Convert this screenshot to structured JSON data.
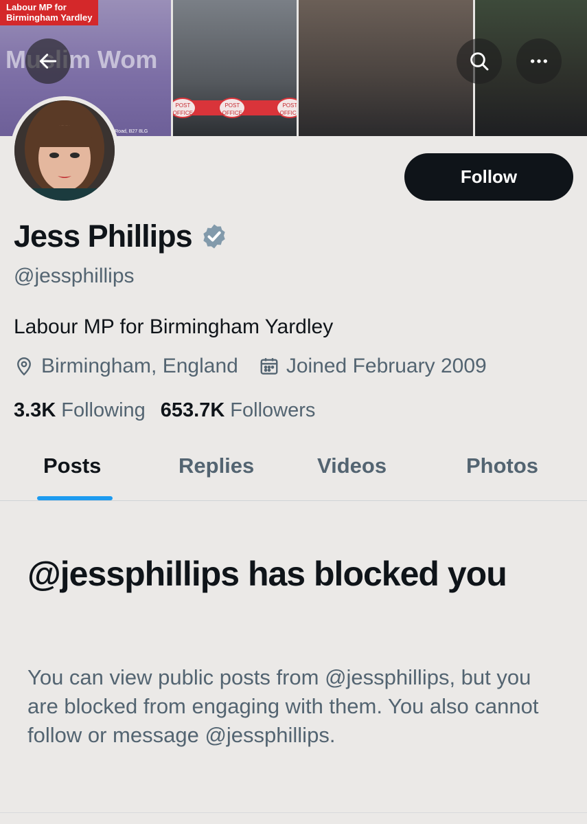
{
  "banner": {
    "caption_line1": "Labour MP for",
    "caption_line2": "Birmingham Yardley",
    "sign_text": "Muslim Wom",
    "post_office_1": "POST OFFICE",
    "post_office_2": "POST OFFICE",
    "post_office_3": "POST OFFICE",
    "small_text": "rdley Road, B27 8LG"
  },
  "header": {
    "back_icon": "arrow-left-icon",
    "search_icon": "search-icon",
    "more_icon": "more-horizontal-icon"
  },
  "profile": {
    "name": "Jess Phillips",
    "handle": "@jessphillips",
    "bio": "Labour MP for Birmingham Yardley",
    "location": "Birmingham, England",
    "joined": "Joined February 2009",
    "following_count": "3.3K",
    "following_label": "Following",
    "followers_count": "653.7K",
    "followers_label": "Followers",
    "follow_button": "Follow",
    "verified_color": "#829aab"
  },
  "tabs": [
    {
      "label": "Posts",
      "active": true
    },
    {
      "label": "Replies",
      "active": false
    },
    {
      "label": "Videos",
      "active": false
    },
    {
      "label": "Photos",
      "active": false
    }
  ],
  "blocked": {
    "title": "@jessphillips has blocked you",
    "description": "You can view public posts from @jessphillips, but you are blocked from engaging with them. You also cannot follow or message @jessphillips."
  },
  "colors": {
    "accent": "#1d9bf0",
    "background": "#ebe9e7",
    "text_primary": "#0f1419",
    "text_secondary": "#536471"
  }
}
